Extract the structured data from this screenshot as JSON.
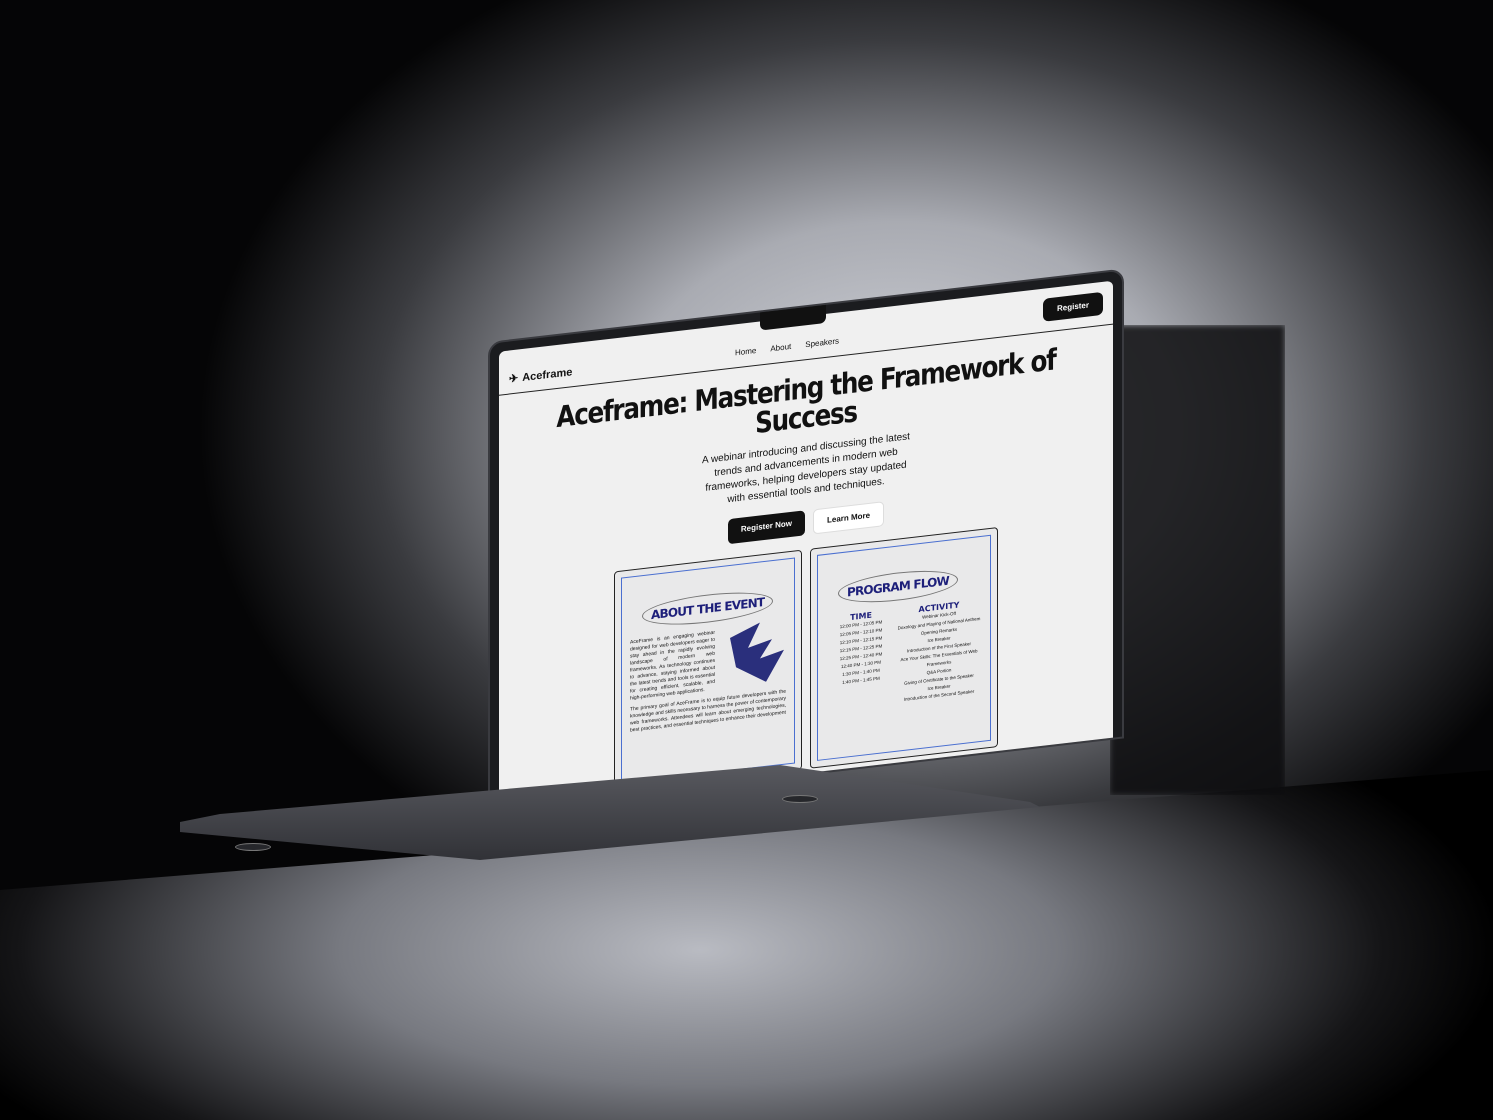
{
  "nav": {
    "logo": "Aceframe",
    "links": [
      "Home",
      "About",
      "Speakers"
    ],
    "register": "Register"
  },
  "hero": {
    "title": "Aceframe: Mastering the Framework of Success",
    "subtitle": "A webinar introducing and discussing the latest trends and advancements in modern web frameworks, helping developers stay updated with essential tools and techniques.",
    "primary": "Register Now",
    "secondary": "Learn More"
  },
  "about": {
    "title": "ABOUT THE EVENT",
    "p1": "AceFrame is an engaging webinar designed for web developers eager to stay ahead in the rapidly evolving landscape of modern web frameworks. As technology continues to advance, staying informed about the latest trends and tools is essential for creating efficient, scalable, and high-performing web applications.",
    "p2": "The primary goal of AceFrame is to equip future developers with the knowledge and skills necessary to harness the power of contemporary web frameworks. Attendees will learn about emerging technologies, best practices, and essential techniques to enhance their development"
  },
  "program": {
    "title": "PROGRAM FLOW",
    "time_header": "TIME",
    "activity_header": "ACTIVITY",
    "times": [
      "12:00 PM - 12:05 PM",
      "12:05 PM - 12:10 PM",
      "12:10 PM - 12:15 PM",
      "12:15 PM - 12:25 PM",
      "12:25 PM - 12:40 PM",
      "12:40 PM - 1:30 PM",
      "1:30 PM - 1:40 PM",
      "1:40 PM - 1:45 PM"
    ],
    "activities": [
      "Webinar Kick-Off",
      "Doxology and Playing of National Anthem",
      "Opening Remarks",
      "Ice Breaker",
      "Introduction of the First Speaker",
      "Ace Your Skills: The Essentials of Web Frameworks",
      "Q&A Portion",
      "Giving of Certificate to the Speaker",
      "Ice Breaker",
      "Introduction of the Second Speaker"
    ]
  }
}
